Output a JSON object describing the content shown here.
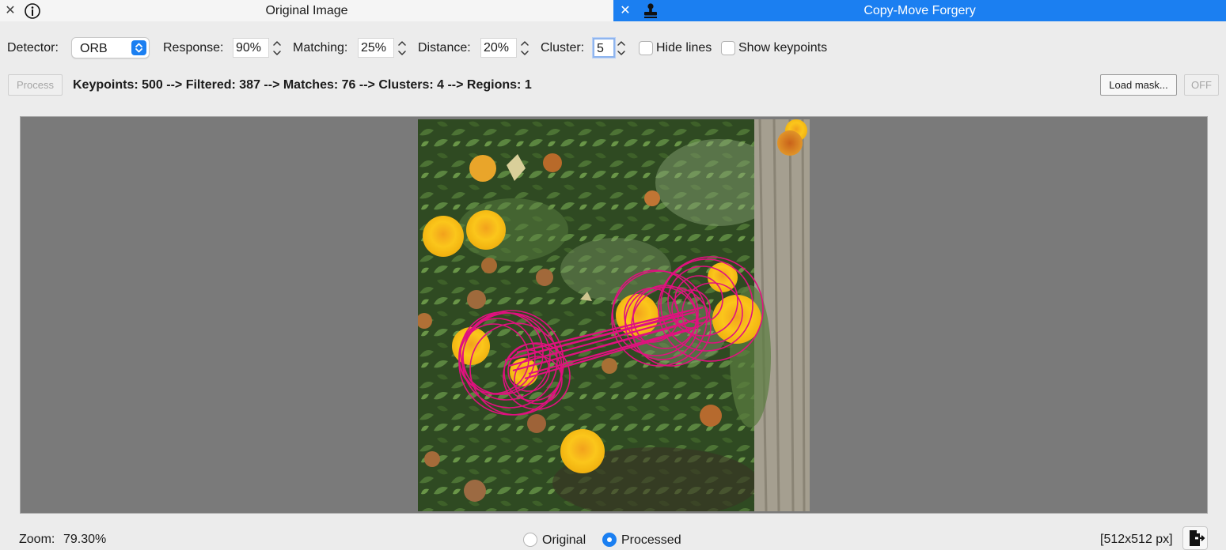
{
  "tabs": [
    {
      "label": "Original Image",
      "icon": "info-icon",
      "active": false
    },
    {
      "label": "Copy-Move Forgery",
      "icon": "stamp-icon",
      "active": true
    }
  ],
  "toolbar": {
    "detector_label": "Detector:",
    "detector_value": "ORB",
    "response_label": "Response:",
    "response_value": "90%",
    "matching_label": "Matching:",
    "matching_value": "25%",
    "distance_label": "Distance:",
    "distance_value": "20%",
    "cluster_label": "Cluster:",
    "cluster_value": "5",
    "hide_lines_label": "Hide lines",
    "show_keypoints_label": "Show keypoints"
  },
  "actions": {
    "process_label": "Process",
    "stats": "Keypoints: 500 --> Filtered: 387 --> Matches: 76 --> Clusters: 4 --> Regions: 1",
    "load_mask_label": "Load mask...",
    "off_label": "OFF"
  },
  "footer": {
    "zoom_label": "Zoom:",
    "zoom_value": "79.30%",
    "view_original_label": "Original",
    "view_processed_label": "Processed",
    "image_size": "[512x512 px]"
  },
  "colors": {
    "accent": "#1b7ff1",
    "match_overlay": "#e0117f"
  }
}
